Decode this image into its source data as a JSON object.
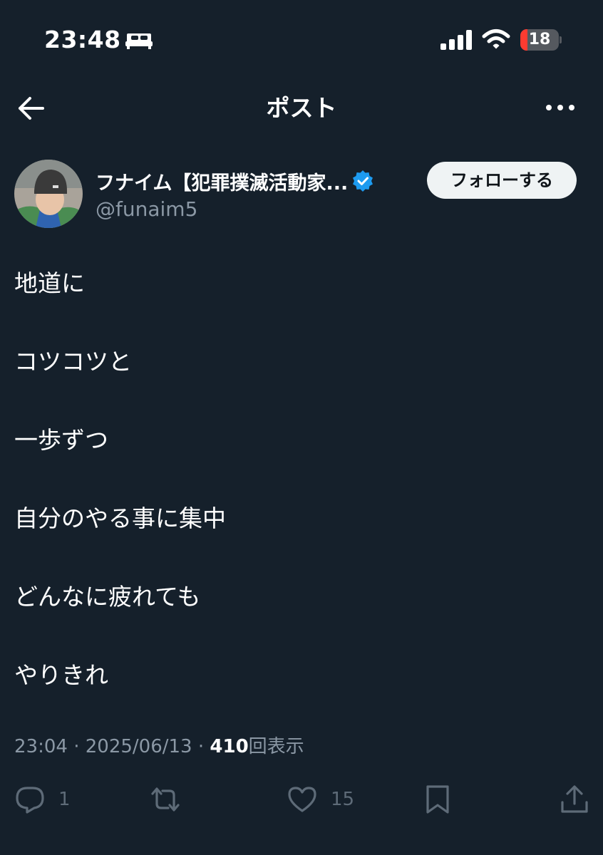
{
  "status_bar": {
    "time": "23:48",
    "battery_level": "18",
    "icons": [
      "sleep-icon",
      "signal-icon",
      "wifi-icon",
      "battery-icon"
    ]
  },
  "nav": {
    "title": "ポスト",
    "back_icon": "arrow-left-icon",
    "more_icon": "more-horizontal-icon"
  },
  "author": {
    "display_name": "フナイム【犯罪撲滅活動家...",
    "handle": "@funaim5",
    "verified": true,
    "follow_label": "フォローする"
  },
  "tweet": {
    "lines": [
      "地道に",
      "",
      "コツコツと",
      "",
      "一歩ずつ",
      "",
      "自分のやる事に集中",
      "",
      "どんなに疲れても",
      "",
      "やりきれ"
    ]
  },
  "meta": {
    "time": "23:04",
    "separator": "·",
    "date": "2025/06/13",
    "views_count": "410",
    "views_label": "回表示"
  },
  "actions": {
    "reply_count": "1",
    "like_count": "15"
  },
  "colors": {
    "background": "#15202b",
    "secondary_text": "#8b98a5",
    "verified_blue": "#1d9bf0",
    "follow_button_bg": "#eff3f4",
    "battery_low": "#ff3b30"
  }
}
